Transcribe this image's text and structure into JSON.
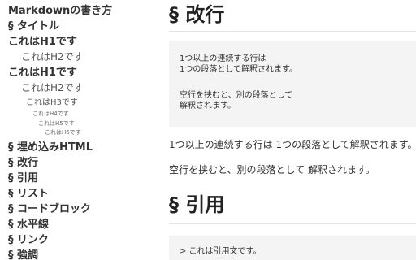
{
  "sidebar": {
    "title": "Markdownの書き方",
    "items": [
      "§ タイトル",
      "これはH1です",
      "これはH2です",
      "これはH1です",
      "これはH2です",
      "これはH3です",
      "これはH4です",
      "これはH5です",
      "これはH6です",
      "§ 埋め込みHTML",
      "§ 改行",
      "§ 引用",
      "§ リスト",
      "§ コードブロック",
      "§ 水平線",
      "§ リンク",
      "§ 強調"
    ]
  },
  "main": {
    "section_linebreak": {
      "heading": "§ 改行",
      "code_lines": [
        "1つ以上の連続する行は",
        "1つの段落として解釈されます。",
        "",
        "空行を挟むと、別の段落として",
        "解釈されます。"
      ],
      "paragraphs": [
        "1つ以上の連続する行は 1つの段落として解釈されます。",
        "空行を挟むと、別の段落として 解釈されます。"
      ]
    },
    "section_quote": {
      "heading": "§ 引用",
      "code_lines": [
        "> これは引用文です。"
      ]
    }
  }
}
